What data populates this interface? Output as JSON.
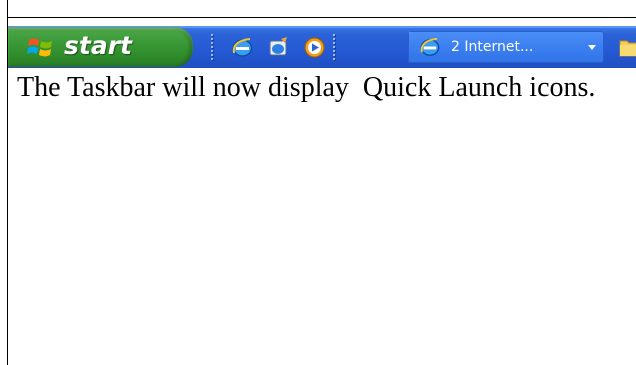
{
  "taskbar": {
    "start_label": "start",
    "start_logo_icon": "windows-flag-icon",
    "quick_launch": [
      {
        "icon": "internet-explorer-icon"
      },
      {
        "icon": "outlook-express-icon"
      },
      {
        "icon": "media-player-icon"
      }
    ],
    "task_button": {
      "icon": "internet-explorer-icon",
      "label": "2 Internet..."
    },
    "folder_icon": "folder-icon"
  },
  "caption": {
    "text": "The Taskbar will now display  Quick Launch icons."
  },
  "colors": {
    "taskbar_blue": "#2459d3",
    "start_green": "#3a9a36",
    "text": "#000000"
  }
}
